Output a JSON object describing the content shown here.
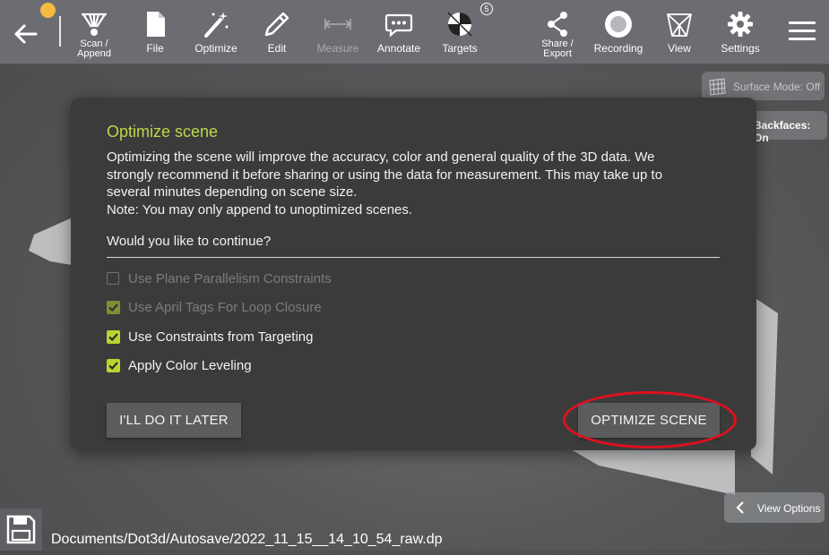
{
  "toolbar": {
    "tools": [
      {
        "id": "scan",
        "label": "Scan / Append",
        "icon": "scan-icon"
      },
      {
        "id": "file",
        "label": "File",
        "icon": "file-icon"
      },
      {
        "id": "optimize",
        "label": "Optimize",
        "icon": "magic-wand-icon"
      },
      {
        "id": "edit",
        "label": "Edit",
        "icon": "pencil-icon"
      },
      {
        "id": "measure",
        "label": "Measure",
        "icon": "measure-icon",
        "disabled": true
      },
      {
        "id": "annotate",
        "label": "Annotate",
        "icon": "speech-bubble-icon"
      },
      {
        "id": "targets",
        "label": "Targets",
        "icon": "target-icon",
        "badge": "5"
      },
      {
        "id": "share",
        "label": "Share / Export",
        "icon": "share-icon"
      },
      {
        "id": "recording",
        "label": "Recording",
        "icon": "record-icon"
      },
      {
        "id": "view",
        "label": "View",
        "icon": "cube-icon"
      },
      {
        "id": "settings",
        "label": "Settings",
        "icon": "gear-icon"
      }
    ],
    "status_color": "#f5bb3f"
  },
  "overlays": {
    "surface_mode": "Surface Mode: Off",
    "backfaces": "Backfaces: On",
    "view_options": "View Options"
  },
  "dialog": {
    "title": "Optimize scene",
    "body_lines": [
      "Optimizing the scene will improve the accuracy, color and general quality of the 3D data. We",
      "strongly recommend it before sharing or using the data for measurement. This may take up to",
      "several minutes depending on scene size.",
      "Note: You may only append to unoptimized scenes."
    ],
    "question": "Would you like to continue?",
    "options": [
      {
        "label": "Use Plane Parallelism Constraints",
        "checked": false,
        "enabled": false
      },
      {
        "label": "Use April Tags For Loop Closure",
        "checked": true,
        "enabled": false
      },
      {
        "label": "Use Constraints from Targeting",
        "checked": true,
        "enabled": true
      },
      {
        "label": "Apply Color Leveling",
        "checked": true,
        "enabled": true
      }
    ],
    "later_button": "I'LL DO IT LATER",
    "optimize_button": "OPTIMIZE SCENE",
    "accent_color": "#bcd947"
  },
  "footer": {
    "file_path": "Documents/Dot3d/Autosave/2022_11_15__14_10_54_raw.dp"
  }
}
